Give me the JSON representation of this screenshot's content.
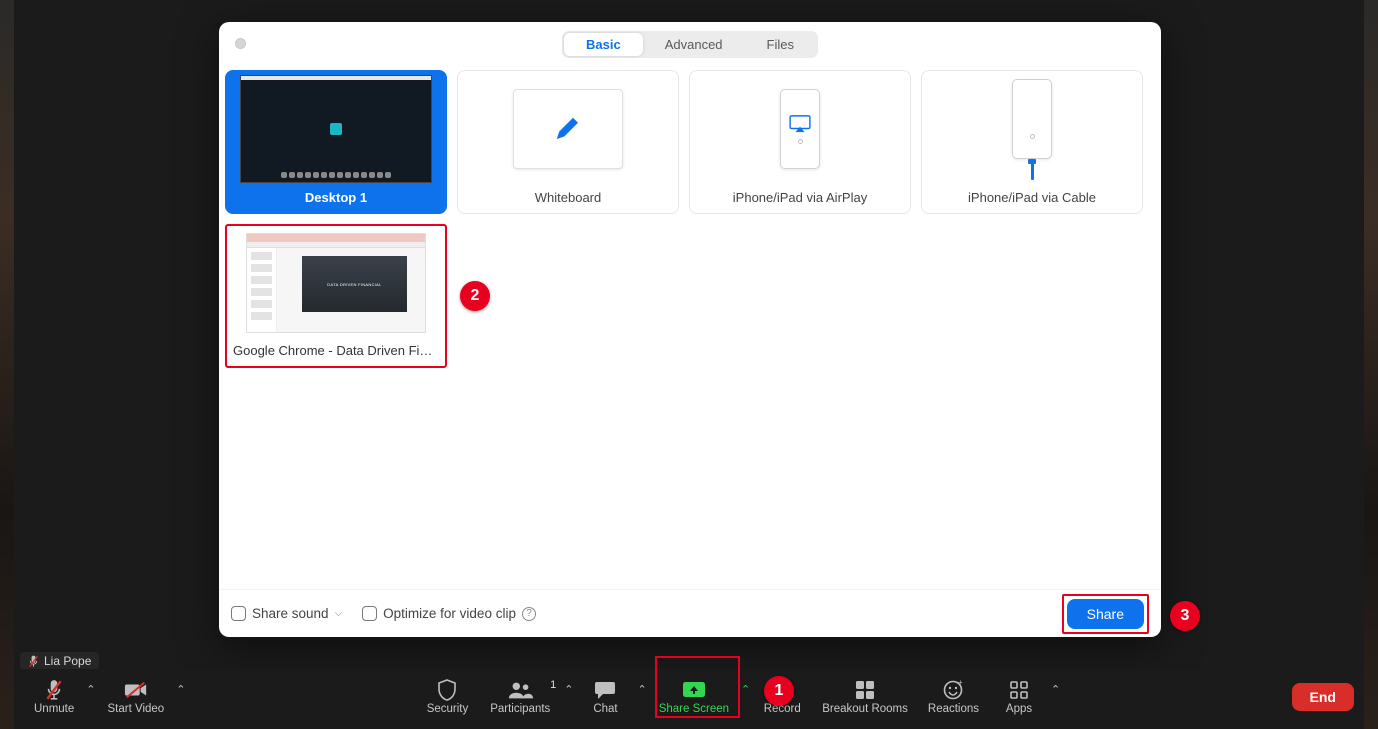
{
  "colors": {
    "accent": "#0e72ed",
    "danger": "#e8001e",
    "success": "#33d651"
  },
  "modal": {
    "tabs": {
      "basic": "Basic",
      "advanced": "Advanced",
      "files": "Files"
    },
    "options": {
      "desktop1": "Desktop 1",
      "whiteboard": "Whiteboard",
      "airplay": "iPhone/iPad via AirPlay",
      "cable": "iPhone/iPad via Cable",
      "chrome": "Google Chrome - Data Driven Fina…"
    },
    "footer": {
      "share_sound": "Share sound",
      "optimize": "Optimize for video clip",
      "help": "?",
      "share_btn": "Share"
    }
  },
  "annotations": {
    "b1": "1",
    "b2": "2",
    "b3": "3"
  },
  "user": {
    "name": "Lia Pope"
  },
  "toolbar": {
    "unmute": "Unmute",
    "start_video": "Start Video",
    "security": "Security",
    "participants": "Participants",
    "participants_count": "1",
    "chat": "Chat",
    "share_screen": "Share Screen",
    "record": "Record",
    "breakout": "Breakout Rooms",
    "reactions": "Reactions",
    "apps": "Apps",
    "end": "End"
  }
}
